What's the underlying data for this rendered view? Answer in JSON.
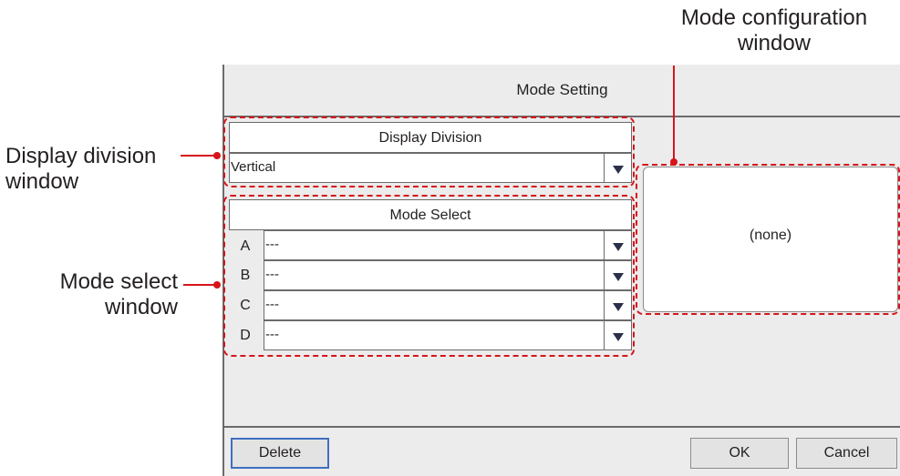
{
  "callouts": {
    "mode_config": "Mode configuration\nwindow",
    "display_division": "Display division\nwindow",
    "mode_select": "Mode select\nwindow"
  },
  "dialog": {
    "title": "Mode Setting",
    "display_division": {
      "header": "Display Division",
      "value": "Vertical"
    },
    "mode_select": {
      "header": "Mode Select",
      "rows": [
        {
          "letter": "A",
          "value": "---"
        },
        {
          "letter": "B",
          "value": "---"
        },
        {
          "letter": "C",
          "value": "---"
        },
        {
          "letter": "D",
          "value": "---"
        }
      ]
    },
    "config_text": "(none)",
    "buttons": {
      "delete": "Delete",
      "ok": "OK",
      "cancel": "Cancel"
    }
  },
  "colors": {
    "callout_red": "#d7141a",
    "dialog_bg": "#ececec",
    "arrow": "#2a2f4a",
    "primary_border": "#3f6fc0"
  },
  "icons": {
    "dropdown": "chevron-down-icon"
  }
}
